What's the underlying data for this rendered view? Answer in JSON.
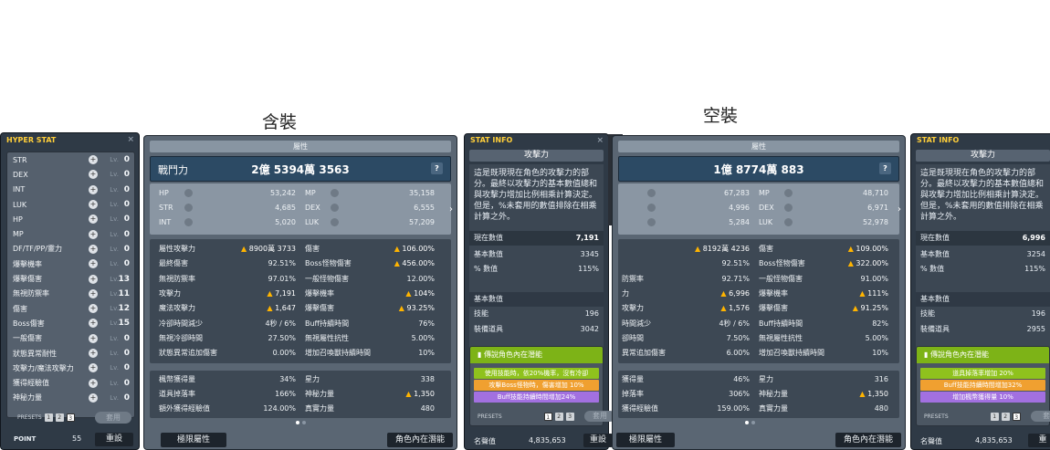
{
  "headings": {
    "with_gear": "含裝",
    "no_gear": "空裝"
  },
  "hyper_stat": {
    "title": "HYPER STAT",
    "rows": [
      {
        "label": "STR",
        "lv": "Lv.",
        "val": "0"
      },
      {
        "label": "DEX",
        "lv": "Lv.",
        "val": "0"
      },
      {
        "label": "INT",
        "lv": "Lv.",
        "val": "0"
      },
      {
        "label": "LUK",
        "lv": "Lv.",
        "val": "0"
      },
      {
        "label": "HP",
        "lv": "Lv.",
        "val": "0"
      },
      {
        "label": "MP",
        "lv": "Lv.",
        "val": "0"
      },
      {
        "label": "DF/TF/PP/靈力",
        "lv": "Lv.",
        "val": "0"
      },
      {
        "label": "爆擊機率",
        "lv": "Lv.",
        "val": "0"
      },
      {
        "label": "爆擊傷害",
        "lv": "Lv.",
        "val": "13"
      },
      {
        "label": "無視防禦率",
        "lv": "Lv.",
        "val": "11"
      },
      {
        "label": "傷害",
        "lv": "Lv.",
        "val": "12"
      },
      {
        "label": "Boss傷害",
        "lv": "Lv.",
        "val": "15"
      },
      {
        "label": "一般傷害",
        "lv": "Lv.",
        "val": "0"
      },
      {
        "label": "狀態異常耐性",
        "lv": "Lv.",
        "val": "0"
      },
      {
        "label": "攻擊力/魔法攻擊力",
        "lv": "Lv.",
        "val": "0"
      },
      {
        "label": "獲得經驗值",
        "lv": "Lv.",
        "val": "0"
      },
      {
        "label": "神秘力量",
        "lv": "Lv.",
        "val": "0"
      }
    ],
    "presets_label": "PRESETS",
    "preset_nums": [
      "1",
      "2",
      "3"
    ],
    "apply": "套用",
    "point_label": "POINT",
    "point_value": "55",
    "reset": "重設"
  },
  "left_stats": {
    "header": "屬性",
    "power_label": "戰鬥力",
    "power_value": "2億 5394萬 3563",
    "base": [
      {
        "k": "HP",
        "v": "53,242",
        "k2": "MP",
        "v2": "35,158"
      },
      {
        "k": "STR",
        "v": "4,685",
        "k2": "DEX",
        "v2": "6,555"
      },
      {
        "k": "INT",
        "v": "5,020",
        "k2": "LUK",
        "v2": "57,209"
      }
    ],
    "detail": [
      {
        "k": "屬性攻擊力",
        "v": "8900萬 3733",
        "up": true,
        "k2": "傷害",
        "v2": "106.00%",
        "up2": true
      },
      {
        "k": "最終傷害",
        "v": "92.51%",
        "k2": "Boss怪物傷害",
        "v2": "456.00%",
        "up2": true
      },
      {
        "k": "無視防禦率",
        "v": "97.01%",
        "k2": "一般怪物傷害",
        "v2": "12.00%"
      },
      {
        "k": "攻擊力",
        "v": "7,191",
        "up": true,
        "k2": "爆擊機率",
        "v2": "104%",
        "up2": true
      },
      {
        "k": "魔法攻擊力",
        "v": "1,647",
        "up": true,
        "k2": "爆擊傷害",
        "v2": "93.25%",
        "up2": true
      },
      {
        "k": "冷卻時間減少",
        "v": "4秒 / 6%",
        "k2": "Buff持續時間",
        "v2": "76%"
      },
      {
        "k": "無視冷卻時間",
        "v": "27.50%",
        "k2": "無視屬性抗性",
        "v2": "5.00%"
      },
      {
        "k": "狀態異常追加傷害",
        "v": "0.00%",
        "k2": "增加召喚獸持續時間",
        "v2": "10%"
      }
    ],
    "extra": [
      {
        "k": "楓幣獲得量",
        "v": "34%",
        "k2": "星力",
        "v2": "338"
      },
      {
        "k": "道具掉落率",
        "v": "166%",
        "k2": "神秘力量",
        "v2": "1,350",
        "up2": true
      },
      {
        "k": "額外獲得經驗值",
        "v": "124.00%",
        "k2": "真實力量",
        "v2": "480"
      }
    ],
    "btn_hyper": "極限屬性",
    "btn_ability": "角色內在潛能"
  },
  "left_info": {
    "title": "STAT INFO",
    "attack": "攻擊力",
    "desc": "這是既現現在角色的攻擊力的部分。最終以攻擊力的基本數值總和與攻擊力增加比例相乘計算決定。但是，%未套用的數值排除在相乘計算之外。",
    "current_label": "現在數值",
    "current_value": "7,191",
    "base_label": "基本數值",
    "base_value": "3345",
    "pct_label": "% 數值",
    "pct_value": "115%",
    "sub_base": "基本數值",
    "skill_label": "技能",
    "skill_value": "196",
    "equip_label": "裝備道具",
    "equip_value": "3042",
    "legend": "傳說角色內在潛能",
    "lines": [
      "使用技能時，依20%機率，沒有冷卻",
      "攻擊Boss怪物時，傷害增加 10%",
      "Buff技能持續時間增加24%"
    ],
    "presets": "PRESETS",
    "preset_nums": [
      "1",
      "2",
      "3"
    ],
    "apply": "套用",
    "fame_label": "名聲值",
    "fame_value": "4,835,653",
    "reset": "重設"
  },
  "right_stats": {
    "header": "屬性",
    "power_value": "1億 8774萬 883",
    "base": [
      {
        "v": "67,283",
        "k2": "MP",
        "v2": "48,710"
      },
      {
        "v": "4,996",
        "k2": "DEX",
        "v2": "6,971"
      },
      {
        "v": "5,284",
        "k2": "LUK",
        "v2": "52,978"
      }
    ],
    "detail": [
      {
        "k": "",
        "v": "8192萬 4236",
        "up": true,
        "k2": "傷害",
        "v2": "109.00%",
        "up2": true
      },
      {
        "k": "",
        "v": "92.51%",
        "k2": "Boss怪物傷害",
        "v2": "322.00%",
        "up2": true
      },
      {
        "k": "防禦率",
        "v": "92.71%",
        "k2": "一般怪物傷害",
        "v2": "91.00%"
      },
      {
        "k": "力",
        "v": "6,996",
        "up": true,
        "k2": "爆擊機率",
        "v2": "111%",
        "up2": true
      },
      {
        "k": "攻擊力",
        "v": "1,576",
        "up": true,
        "k2": "爆擊傷害",
        "v2": "91.25%",
        "up2": true
      },
      {
        "k": "時間減少",
        "v": "4秒 / 6%",
        "k2": "Buff持續時間",
        "v2": "82%"
      },
      {
        "k": "卻時間",
        "v": "7.50%",
        "k2": "無視屬性抗性",
        "v2": "5.00%"
      },
      {
        "k": "異常追加傷害",
        "v": "6.00%",
        "k2": "增加召喚獸持續時間",
        "v2": "10%"
      }
    ],
    "extra": [
      {
        "k": "獲得量",
        "v": "46%",
        "k2": "星力",
        "v2": "316"
      },
      {
        "k": "掉落率",
        "v": "306%",
        "k2": "神秘力量",
        "v2": "1,350",
        "up2": true
      },
      {
        "k": "獲得經驗值",
        "v": "159.00%",
        "k2": "真實力量",
        "v2": "480"
      }
    ],
    "btn_hyper": "極限屬性",
    "btn_ability": "角色內在潛能"
  },
  "right_info": {
    "title": "STAT INFO",
    "attack": "攻擊力",
    "desc": "這是既現現在角色的攻擊力的部分。最終以攻擊力的基本數值總和與攻擊力增加比例相乘計算決定。但是，%未套用的數值排除在相乘計算之外。",
    "current_label": "現在數值",
    "current_value": "6,996",
    "base_label": "基本數值",
    "base_value": "3254",
    "pct_label": "% 數值",
    "pct_value": "115%",
    "sub_base": "基本數值",
    "skill_label": "技能",
    "skill_value": "196",
    "equip_label": "裝備道具",
    "equip_value": "2955",
    "legend": "傳說角色內在潛能",
    "lines": [
      "道具掉落率增加 20%",
      "Buff技能持續時間增加32%",
      "增加楓幣獲得量 10%"
    ],
    "presets": "PRESETS",
    "preset_nums": [
      "1",
      "2",
      "3"
    ],
    "apply": "套",
    "fame_label": "名聲值",
    "fame_value": "4,835,653",
    "reset": "重"
  }
}
